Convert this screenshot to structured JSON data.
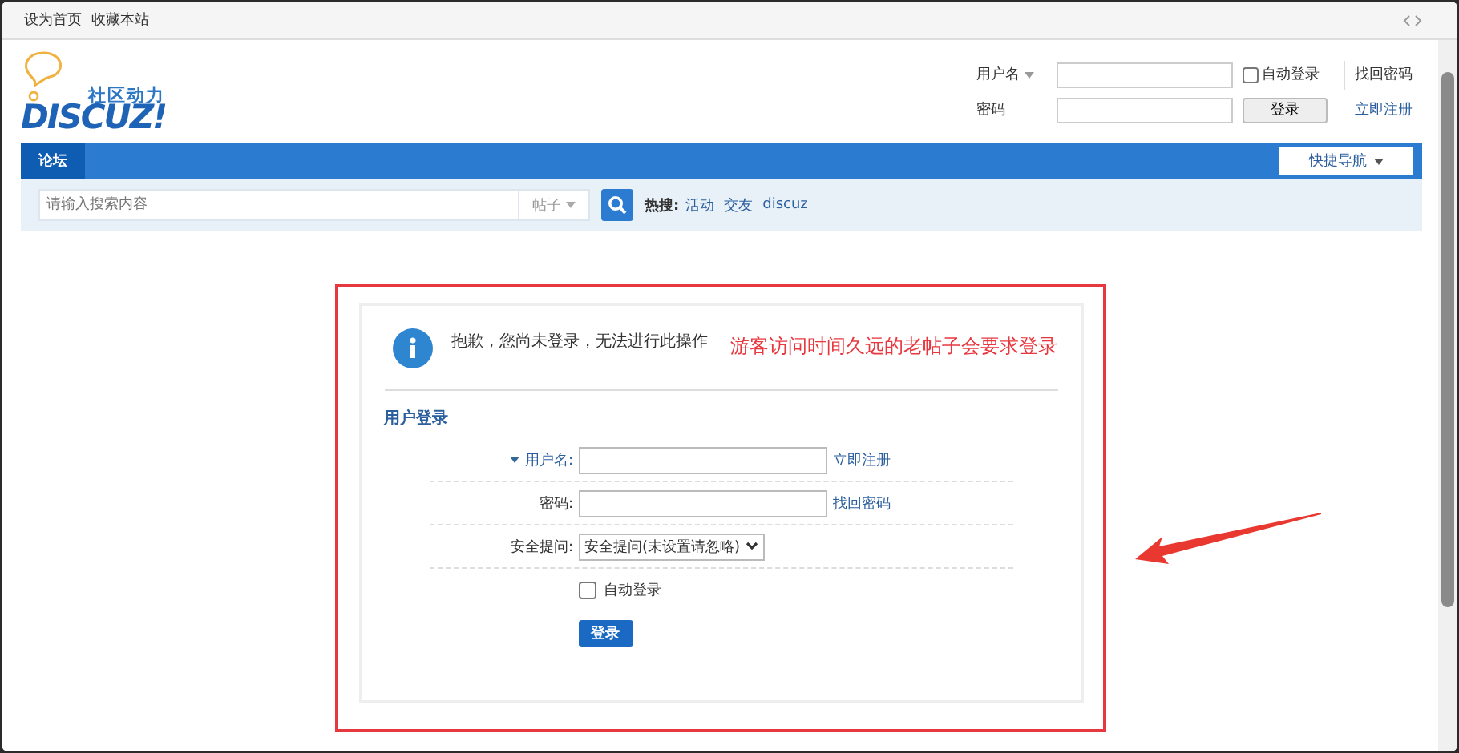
{
  "top_bar": {
    "links": [
      "设为首页",
      "收藏本站"
    ]
  },
  "logo": {
    "tagline": "社区动力",
    "wordmark": "DISCUZ!"
  },
  "header_login": {
    "username_label": "用户名",
    "auto_login": {
      "label": "自动登录",
      "checked": false
    },
    "forgot_link": "找回密码",
    "password_label": "密码",
    "login_button": "登录",
    "register_link": "立即注册"
  },
  "nav": {
    "tabs": [
      {
        "label": "论坛",
        "selected": true
      }
    ],
    "quick_nav": "快捷导航"
  },
  "search": {
    "placeholder": "请输入搜索内容",
    "scope": "帖子",
    "hot_label": "热搜:",
    "hot_links": [
      "活动",
      "交友",
      "discuz"
    ]
  },
  "message": {
    "text": "抱歉，您尚未登录，无法进行此操作",
    "annotation": "游客访问时间久远的老帖子会要求登录"
  },
  "login_form": {
    "title": "用户登录",
    "rows": [
      {
        "kind": "input",
        "label": "用户名:",
        "caret": true,
        "link": "立即注册"
      },
      {
        "kind": "input",
        "label": "密码:",
        "caret": false,
        "link": "找回密码"
      },
      {
        "kind": "select",
        "label": "安全提问:",
        "value": "安全提问(未设置请忽略)"
      },
      {
        "kind": "checkbox",
        "label": "自动登录",
        "checked": false
      },
      {
        "kind": "button",
        "label": "登录"
      }
    ]
  }
}
